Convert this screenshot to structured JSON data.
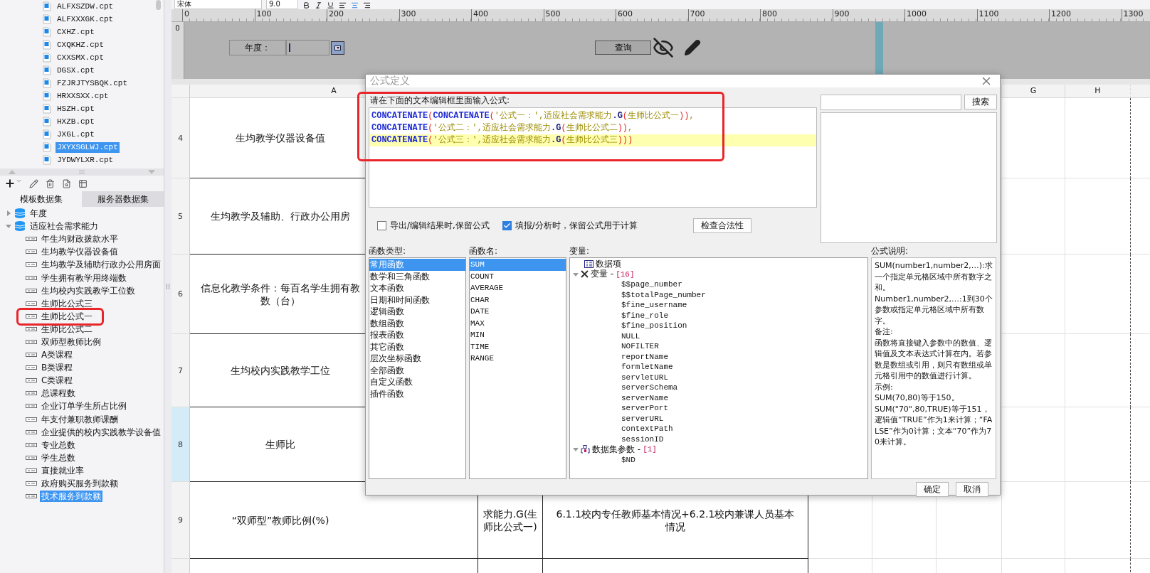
{
  "toolbar": {
    "font": "宋体",
    "size": "9.0"
  },
  "files": [
    {
      "label": "ALFXSZDW.cpt",
      "selected": false
    },
    {
      "label": "ALFXXXGK.cpt",
      "selected": false
    },
    {
      "label": "CXHZ.cpt",
      "selected": false
    },
    {
      "label": "CXQKHZ.cpt",
      "selected": false
    },
    {
      "label": "CXXSMX.cpt",
      "selected": false
    },
    {
      "label": "DGSX.cpt",
      "selected": false
    },
    {
      "label": "FZJRJTYSBQK.cpt",
      "selected": false
    },
    {
      "label": "HRXXSXX.cpt",
      "selected": false
    },
    {
      "label": "HSZH.cpt",
      "selected": false
    },
    {
      "label": "HXZB.cpt",
      "selected": false
    },
    {
      "label": "JXGL.cpt",
      "selected": false
    },
    {
      "label": "JXYXSGLWJ.cpt",
      "selected": true
    },
    {
      "label": "JYDWYLXR.cpt",
      "selected": false
    }
  ],
  "dataset_tabs": [
    {
      "label": "模板数据集",
      "selected": true
    },
    {
      "label": "服务器数据集",
      "selected": false
    }
  ],
  "datasets": [
    {
      "label": "年度",
      "expanded": false,
      "selected": false
    },
    {
      "label": "适应社会需求能力",
      "expanded": true,
      "selected": false,
      "children": [
        {
          "label": "年生均财政拨款水平",
          "selected": false
        },
        {
          "label": "生均教学仪器设备值",
          "selected": false
        },
        {
          "label": "生均教学及辅助行政办公用房面",
          "selected": false
        },
        {
          "label": "学生拥有教学用终端数",
          "selected": false
        },
        {
          "label": "生均校内实践教学工位数",
          "selected": false
        },
        {
          "label": "生师比公式三",
          "selected": false
        },
        {
          "label": "生师比公式一",
          "selected": false
        },
        {
          "label": "生师比公式二",
          "selected": false
        },
        {
          "label": "双师型教师比例",
          "selected": false
        },
        {
          "label": "A类课程",
          "selected": false
        },
        {
          "label": "B类课程",
          "selected": false
        },
        {
          "label": "C类课程",
          "selected": false
        },
        {
          "label": "总课程数",
          "selected": false
        },
        {
          "label": "企业订单学生所占比例",
          "selected": false
        },
        {
          "label": "年支付兼职教师课酬",
          "selected": false
        },
        {
          "label": "企业提供的校内实践教学设备值",
          "selected": false
        },
        {
          "label": "专业总数",
          "selected": false
        },
        {
          "label": "学生总数",
          "selected": false
        },
        {
          "label": "直接就业率",
          "selected": false
        },
        {
          "label": "政府购买服务到款额",
          "selected": false
        },
        {
          "label": "技术服务到款额",
          "selected": true
        }
      ]
    }
  ],
  "vertical_ruler": "0",
  "ruler": [
    "0",
    "100",
    "200",
    "300",
    "400",
    "500",
    "600",
    "700",
    "800",
    "900",
    "1000",
    "1100",
    "1200",
    "1300"
  ],
  "parameters": {
    "label": "年度：",
    "query_button": "查询"
  },
  "column_headers": [
    "A",
    "G",
    "H"
  ],
  "rows": [
    {
      "number": "4",
      "selected": false,
      "cells": [
        [
          "生均教学仪器设备值"
        ]
      ]
    },
    {
      "number": "5",
      "selected": false,
      "cells": [
        [
          "生均教学及辅助、行政办公用房"
        ]
      ]
    },
    {
      "number": "6",
      "selected": false,
      "cells": [
        [
          "信息化教学条件：每百名学生拥有教",
          "数（台）"
        ]
      ]
    },
    {
      "number": "7",
      "selected": false,
      "cells": [
        [
          "生均校内实践教学工位"
        ]
      ]
    },
    {
      "number": "8",
      "selected": true,
      "cells": [
        [
          "生师比"
        ]
      ]
    },
    {
      "number": "9",
      "selected": false,
      "cells": [
        [
          "“双师型”教师比例(%)"
        ],
        [
          "求能力.G(生",
          "师比公式一)"
        ],
        [
          "6.1.1校内专任教师基本情况+6.2.1校内兼课人员基本",
          "情况"
        ]
      ]
    }
  ],
  "dialog": {
    "title": "公式定义",
    "prompt": "请在下面的文本编辑框里面输入公式:",
    "formula": [
      {
        "current": false,
        "tokens": [
          {
            "kind": "fn",
            "text": "CONCATENATE"
          },
          {
            "kind": "paren",
            "text": "("
          },
          {
            "kind": "fn",
            "text": "CONCATENATE"
          },
          {
            "kind": "paren",
            "text": "("
          },
          {
            "kind": "text",
            "text": "'公式一：',适应社会需求能力"
          },
          {
            "kind": "member",
            "text": ".G"
          },
          {
            "kind": "paren",
            "text": "("
          },
          {
            "kind": "text",
            "text": "生师比公式一"
          },
          {
            "kind": "paren",
            "text": "))"
          },
          {
            "kind": "text",
            "text": ","
          }
        ]
      },
      {
        "current": false,
        "tokens": [
          {
            "kind": "fn",
            "text": "CONCATENATE"
          },
          {
            "kind": "paren",
            "text": "("
          },
          {
            "kind": "text",
            "text": "'公式二：',适应社会需求能力"
          },
          {
            "kind": "member",
            "text": ".G"
          },
          {
            "kind": "paren",
            "text": "("
          },
          {
            "kind": "text",
            "text": "生师比公式二"
          },
          {
            "kind": "paren",
            "text": "))"
          },
          {
            "kind": "text",
            "text": ","
          }
        ]
      },
      {
        "current": true,
        "tokens": [
          {
            "kind": "fn",
            "text": "CONCATENATE"
          },
          {
            "kind": "paren",
            "text": "("
          },
          {
            "kind": "text",
            "text": "'公式三：',适应社会需求能力"
          },
          {
            "kind": "member",
            "text": ".G"
          },
          {
            "kind": "paren",
            "text": "("
          },
          {
            "kind": "text",
            "text": "生师比公式三"
          },
          {
            "kind": "paren",
            "text": ")))"
          }
        ]
      }
    ],
    "search_button": "搜索",
    "options": [
      {
        "label": "导出/编辑结果时,保留公式",
        "checked": false
      },
      {
        "label": "填报/分析时，保留公式用于计算",
        "checked": true
      }
    ],
    "check_button": "检查合法性",
    "types_label": "函数类型:",
    "types": [
      {
        "label": "常用函数",
        "selected": true
      },
      {
        "label": "数学和三角函数",
        "selected": false
      },
      {
        "label": "文本函数",
        "selected": false
      },
      {
        "label": "日期和时间函数",
        "selected": false
      },
      {
        "label": "逻辑函数",
        "selected": false
      },
      {
        "label": "数组函数",
        "selected": false
      },
      {
        "label": "报表函数",
        "selected": false
      },
      {
        "label": "其它函数",
        "selected": false
      },
      {
        "label": "层次坐标函数",
        "selected": false
      },
      {
        "label": "全部函数",
        "selected": false
      },
      {
        "label": "自定义函数",
        "selected": false
      },
      {
        "label": "插件函数",
        "selected": false
      }
    ],
    "names_label": "函数名:",
    "names": [
      {
        "label": "SUM",
        "selected": true
      },
      {
        "label": "COUNT",
        "selected": false
      },
      {
        "label": "AVERAGE",
        "selected": false
      },
      {
        "label": "CHAR",
        "selected": false
      },
      {
        "label": "DATE",
        "selected": false
      },
      {
        "label": "MAX",
        "selected": false
      },
      {
        "label": "MIN",
        "selected": false
      },
      {
        "label": "TIME",
        "selected": false
      },
      {
        "label": "RANGE",
        "selected": false
      }
    ],
    "variables_label": "变量:",
    "variables": [
      {
        "kind": "item",
        "label": "数据项"
      },
      {
        "kind": "group",
        "label": "变量 - ",
        "count": "[16]",
        "expanded": true,
        "children": [
          {
            "label": "$$page_number"
          },
          {
            "label": "$$totalPage_number"
          },
          {
            "label": "$fine_username"
          },
          {
            "label": "$fine_role"
          },
          {
            "label": "$fine_position"
          },
          {
            "label": "NULL"
          },
          {
            "label": "NOFILTER"
          },
          {
            "label": "reportName"
          },
          {
            "label": "formletName"
          },
          {
            "label": "servletURL"
          },
          {
            "label": "serverSchema"
          },
          {
            "label": "serverName"
          },
          {
            "label": "serverPort"
          },
          {
            "label": "serverURL"
          },
          {
            "label": "contextPath"
          },
          {
            "label": "sessionID"
          }
        ]
      },
      {
        "kind": "dataset",
        "label": "数据集参数 - ",
        "count": "[1]",
        "expanded": true,
        "children": [
          {
            "label": "$ND"
          }
        ]
      }
    ],
    "description_label": "公式说明:",
    "description": [
      "SUM(number1,number2,…):求一个指定单元格区域中所有数字之和。",
      "Number1,number2,…:1到30个参数或指定单元格区域中所有数字。",
      "备注:",
      "函数将直接键入参数中的数值、逻辑值及文本表达式计算在内。若参数是数组或引用，则只有数组或单元格引用中的数值进行计算。",
      "示例:",
      "SUM(70,80)等于150。",
      "SUM(\"70\",80,TRUE)等于151，逻辑值“TRUE”作为1来计算；“FALSE”作为0计算；文本“70”作为70来计算。"
    ],
    "ok_button": "确定",
    "cancel_button": "取消"
  }
}
